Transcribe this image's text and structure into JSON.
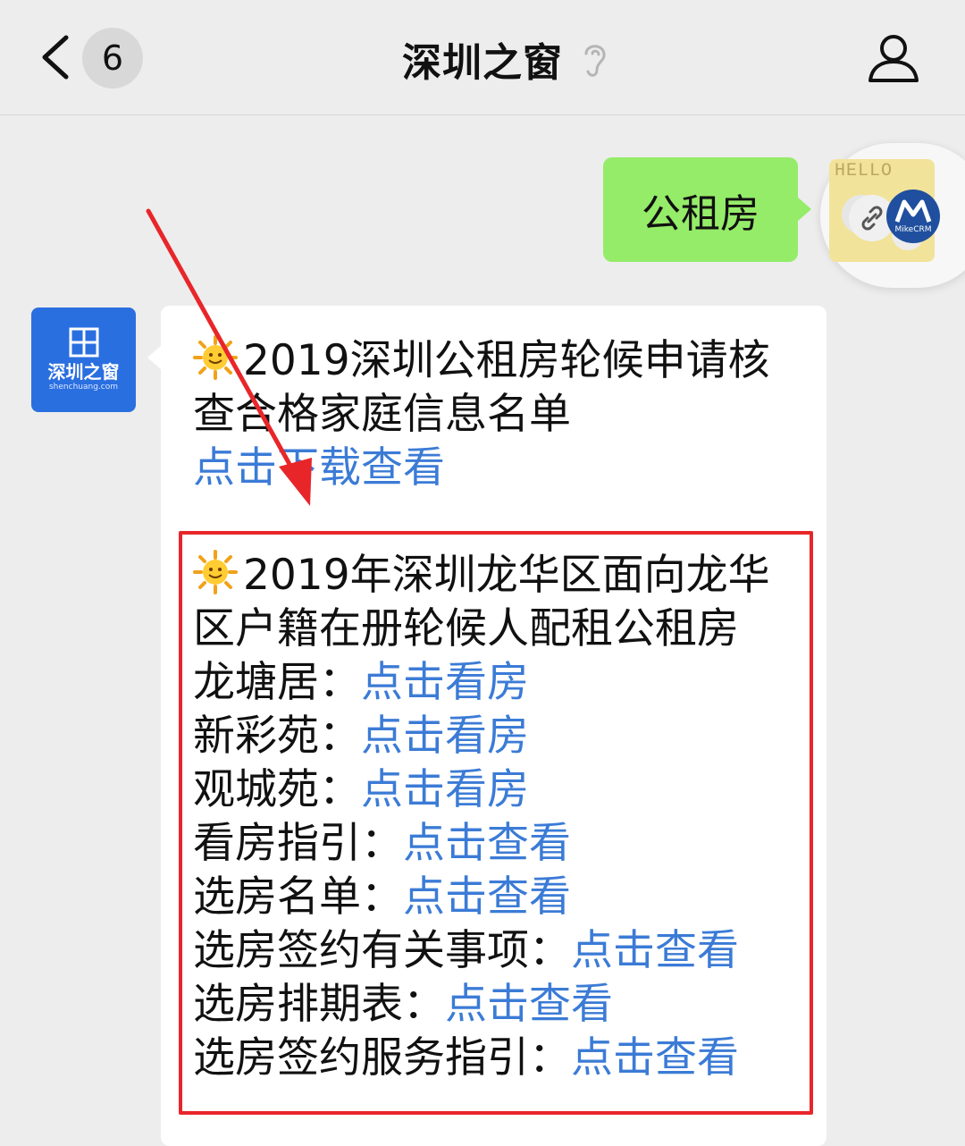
{
  "header": {
    "title": "深圳之窗",
    "unread_count": "6"
  },
  "sent_message": {
    "text": "公租房"
  },
  "user_avatar": {
    "text": "HELLO"
  },
  "floating_widget": {
    "brand": "MikeCRM"
  },
  "account_avatar": {
    "name": "深圳之窗",
    "url": "shenchuang.com"
  },
  "message": {
    "item1": {
      "title_line1": "2019深圳公租房轮候申请核",
      "title_line2": "查合格家庭信息名单",
      "link": "点击下载查看"
    },
    "item2": {
      "title_line1": "2019年深圳龙华区面向龙华",
      "title_line2": "区户籍在册轮候人配租公租房",
      "rows": [
        {
          "label": "龙塘居：",
          "link": "点击看房"
        },
        {
          "label": "新彩苑：",
          "link": "点击看房"
        },
        {
          "label": "观城苑：",
          "link": "点击看房"
        },
        {
          "label": "看房指引：",
          "link": "点击查看"
        },
        {
          "label": "选房名单：",
          "link": "点击查看"
        },
        {
          "label": "选房签约有关事项：",
          "link": "点击查看"
        },
        {
          "label": "选房排期表：",
          "link": "点击查看"
        },
        {
          "label": "选房签约服务指引：",
          "link": "点击查看"
        }
      ]
    }
  },
  "colors": {
    "background": "#ededed",
    "sent_bubble": "#95ec69",
    "link": "#3b7bd6",
    "annotation_red": "#e8262a",
    "account_blue": "#2a6fe0"
  },
  "icons": {
    "back": "chevron-left-icon",
    "ear": "ear-icon",
    "profile": "person-icon",
    "emoji": "sun-emoji-icon",
    "link": "link-icon"
  }
}
